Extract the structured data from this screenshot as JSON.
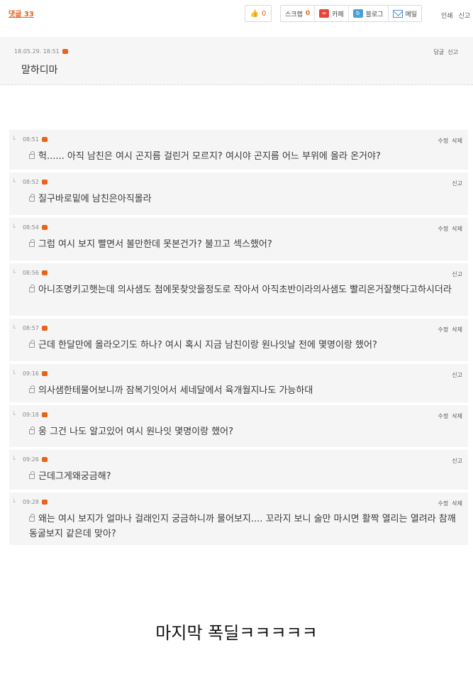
{
  "header": {
    "comment_count": "댓글 33",
    "like_count": "0",
    "scrap_label": "스크랩",
    "scrap_count": "0",
    "cafe_label": "카페",
    "blog_label": "블로그",
    "mail_label": "메일",
    "print_label": "인쇄",
    "report_label": "신고"
  },
  "first_comment": {
    "timestamp": "18.05.29. 18:51",
    "reply_label": "답글",
    "report_label": "신고",
    "text": "말하디마"
  },
  "replies": [
    {
      "time": "08:51",
      "actions": [
        "수정",
        "삭제"
      ],
      "text": "헉...... 아직 남친은 여시 곤지름 걸린거 모르지? 여시야 곤지름 어느 부위에 올라 온거야?"
    },
    {
      "time": "08:52",
      "actions": [
        "신고"
      ],
      "text": "질구바로밑에 남친은아직몰라"
    },
    {
      "time": "08:54",
      "actions": [
        "수정",
        "삭제"
      ],
      "text": "그럼 여시 보지 빨면서 볼만한데 못본건가? 불끄고 섹스했어?"
    },
    {
      "time": "08:56",
      "actions": [
        "신고"
      ],
      "text": "아니조명키고햇는데 의사샘도 첨에못찾앗을정도로 작아서 아직초반이라의사샘도 빨리온거잘햇다고하시더라"
    },
    {
      "time": "08:57",
      "actions": [
        "수정",
        "삭제"
      ],
      "text": "근데 한달만에 올라오기도 하나? 여시 혹시 지금 남친이랑 원나잇날 전에 몇명이랑 했어?"
    },
    {
      "time": "09:16",
      "actions": [
        "신고"
      ],
      "text": "의사샘한테물어보니까 잠복기잇어서 세네달에서 육개월지나도 가능하대"
    },
    {
      "time": "09:18",
      "actions": [
        "수정",
        "삭제"
      ],
      "text": "웅 그건 나도 알고있어 여시 원나잇 몇명이랑 했어?"
    },
    {
      "time": "09:26",
      "actions": [
        "신고"
      ],
      "text": "근데그게왜궁금해?"
    },
    {
      "time": "09:28",
      "actions": [
        "수정",
        "삭제"
      ],
      "text": "왜는 여시 보지가 얼마나 걸래인지 궁금하니까 물어보지.... 꼬라지 보니 술만 마시면 활짝 열리는 열려라 참깨 동굴보지 같은데 맞아?"
    }
  ],
  "caption": "마지막 폭딜ㅋㅋㅋㅋㅋ"
}
